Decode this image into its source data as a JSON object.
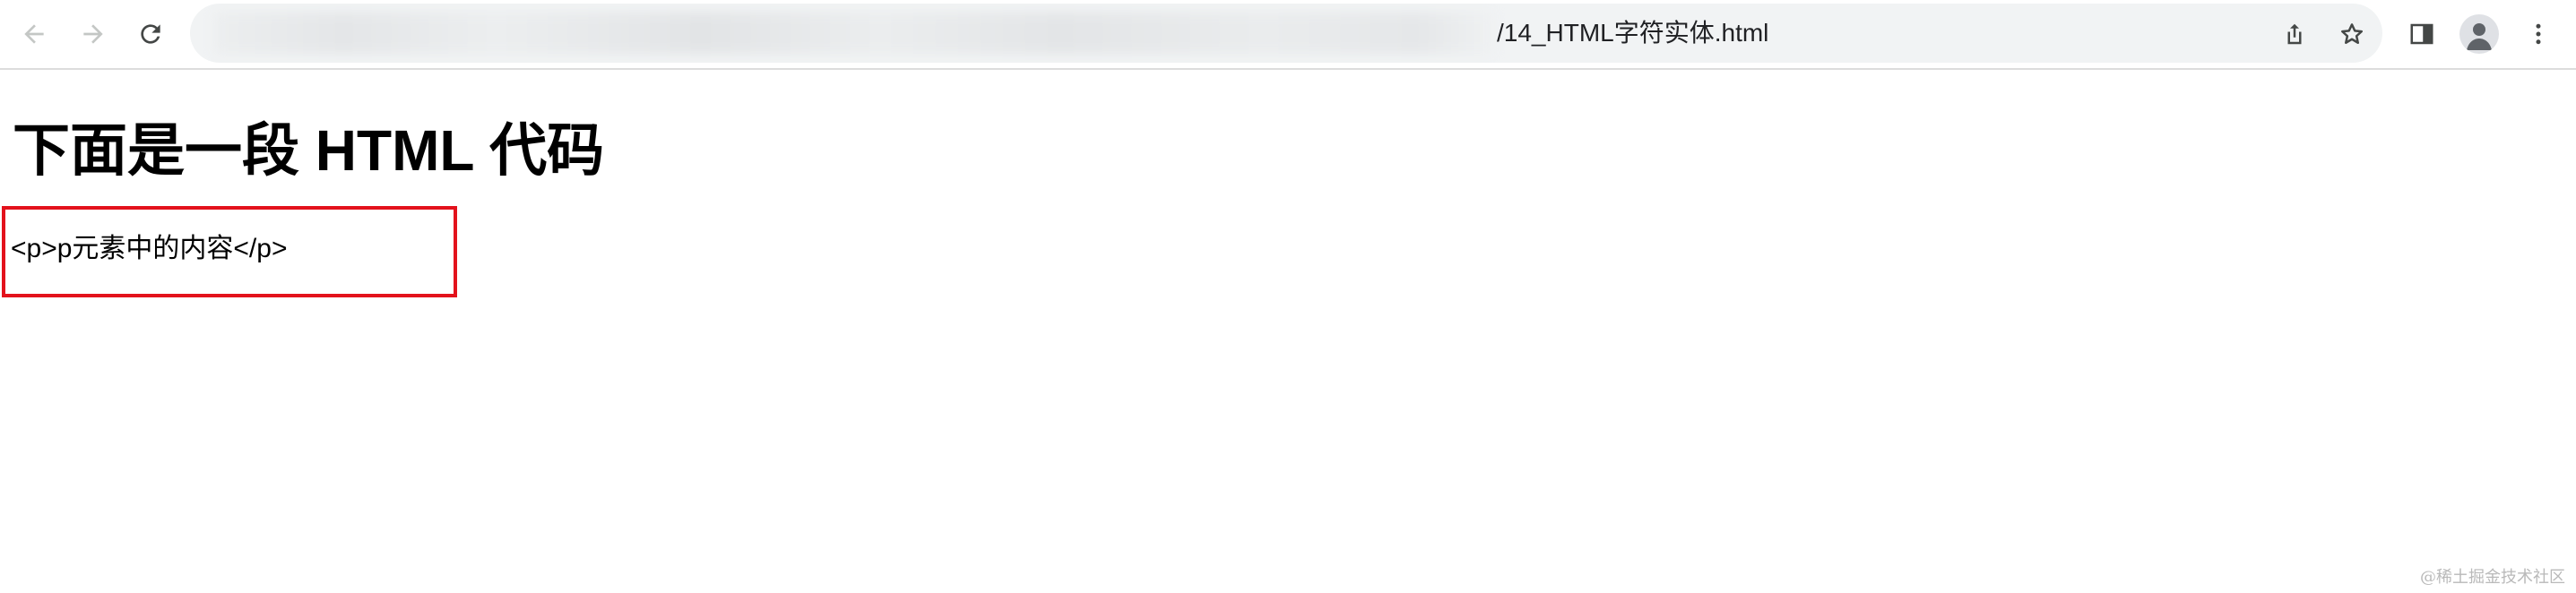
{
  "browser": {
    "url_visible": "/14_HTML字符实体.html"
  },
  "page": {
    "heading": "下面是一段 HTML 代码",
    "code_text": "<p>p元素中的内容</p>"
  },
  "highlight": {
    "color": "#e3121c"
  },
  "watermark": "@稀土掘金技术社区",
  "icons": [
    "back-arrow-icon",
    "forward-arrow-icon",
    "reload-icon",
    "share-icon",
    "bookmark-star-icon",
    "side-panel-icon",
    "profile-avatar-icon",
    "kebab-menu-icon"
  ]
}
